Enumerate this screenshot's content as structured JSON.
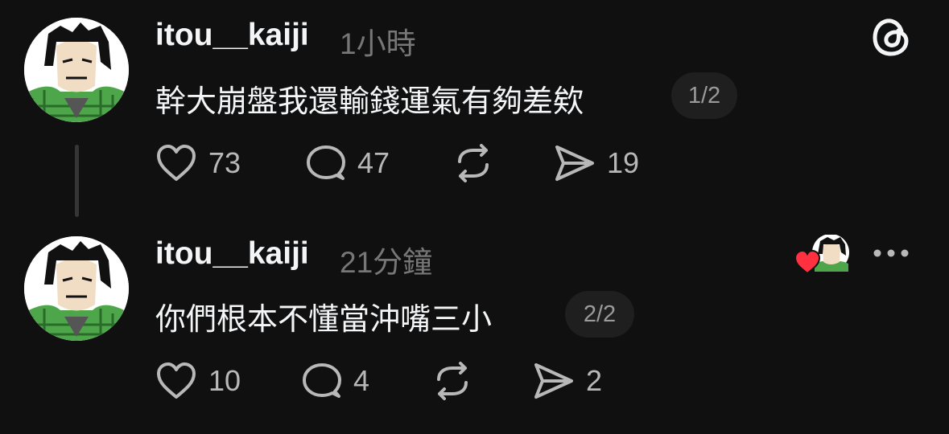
{
  "posts": [
    {
      "username": "itou__kaiji",
      "time": "1小時",
      "text": "幹大崩盤我還輸錢運氣有夠差欸",
      "page": "1/2",
      "actions": {
        "likes": "73",
        "replies": "47",
        "shares": "19"
      }
    },
    {
      "username": "itou__kaiji",
      "time": "21分鐘",
      "text": "你們根本不懂當沖嘴三小",
      "page": "2/2",
      "actions": {
        "likes": "10",
        "replies": "4",
        "shares": "2"
      }
    }
  ],
  "icons": {
    "app_logo": "threads-logo-icon",
    "like": "heart-icon",
    "reply": "comment-bubble-icon",
    "repost": "repost-icon",
    "share": "send-icon",
    "more": "more-dots-icon",
    "liked_by": "heart-filled-icon"
  },
  "colors": {
    "background": "#101010",
    "text_primary": "#f3f5f7",
    "text_secondary": "#777777",
    "like_red": "#ff3040"
  }
}
